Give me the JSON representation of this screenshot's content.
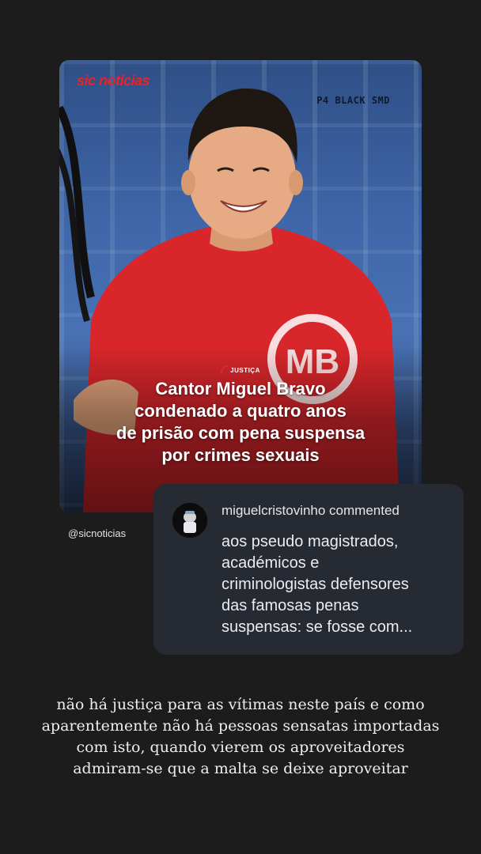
{
  "post": {
    "brand": "sic notícias",
    "case_label": "P4 BLACK SMD",
    "shirt_logo": "MB",
    "category": "JUSTIÇA",
    "headline_lines": [
      "Cantor Miguel Bravo",
      "condenado a quatro anos",
      "de prisão com pena suspensa",
      "por crimes sexuais"
    ],
    "handle": "@sicnoticias"
  },
  "comment": {
    "username": "miguelcristovinho",
    "action": "commented",
    "user_line": "miguelcristovinho commented",
    "text_lines": [
      "aos pseudo magistrados,",
      "académicos e",
      "criminologistas defensores",
      "das famosas penas",
      "suspensas: se fosse com..."
    ]
  },
  "caption_lines": [
    "não há justiça para as vítimas neste país e como",
    "aparentemente não há pessoas sensatas importadas",
    "com isto, quando vierem os aproveitadores",
    "admiram-se que a malta se deixe aproveitar"
  ],
  "colors": {
    "background": "#1c1c1c",
    "brand_red": "#e8232a",
    "shirt_red": "#d8262b",
    "comment_card": "#262a33"
  }
}
